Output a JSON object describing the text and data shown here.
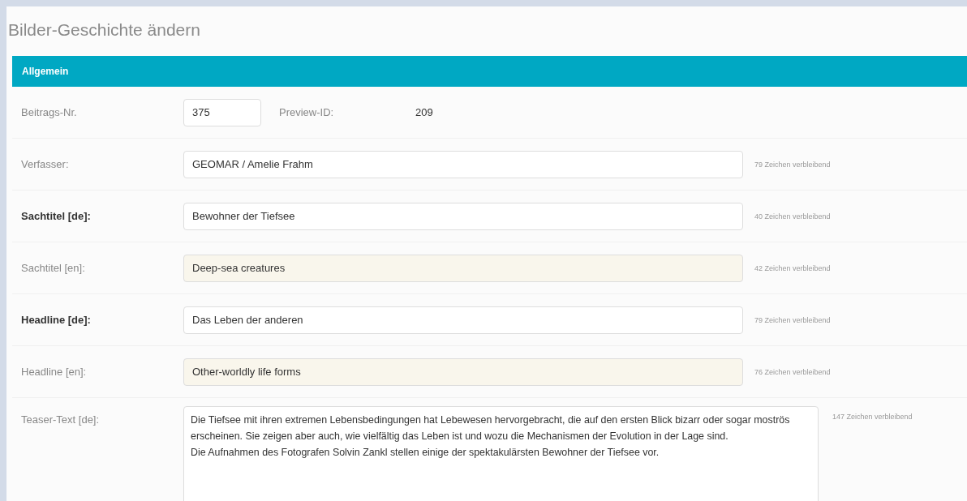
{
  "title": "Bilder-Geschichte ändern",
  "section": {
    "title": "Allgemein"
  },
  "id_row": {
    "label": "Beitrags-Nr.",
    "value": "375",
    "preview_label": "Preview-ID:",
    "preview_value": "209"
  },
  "fields": [
    {
      "label": "Verfasser:",
      "value": "GEOMAR / Amelie Frahm",
      "hint": "79 Zeichen verbleibend",
      "required": false,
      "shaded": false
    },
    {
      "label": "Sachtitel [de]:",
      "value": "Bewohner der Tiefsee",
      "hint": "40 Zeichen verbleibend",
      "required": true,
      "shaded": false
    },
    {
      "label": "Sachtitel [en]:",
      "value": "Deep-sea creatures",
      "hint": "42 Zeichen verbleibend",
      "required": false,
      "shaded": true
    },
    {
      "label": "Headline [de]:",
      "value": "Das Leben der anderen",
      "hint": "79 Zeichen verbleibend",
      "required": true,
      "shaded": false
    },
    {
      "label": "Headline [en]:",
      "value": "Other-worldly life forms",
      "hint": "76 Zeichen verbleibend",
      "required": false,
      "shaded": true
    }
  ],
  "teaser": {
    "label": "Teaser-Text [de]:",
    "value": "Die Tiefsee mit ihren extremen Lebensbedingungen hat Lebewesen hervorgebracht, die auf den ersten Blick bizarr oder sogar moströs erscheinen. Sie zeigen aber auch, wie vielfältig das Leben ist und wozu die Mechanismen der Evolution in der Lage sind.\nDie Aufnahmen des Fotografen Solvin Zankl stellen einige der spektakulärsten Bewohner der Tiefsee vor.",
    "hint": "147 Zeichen verbleibend"
  }
}
